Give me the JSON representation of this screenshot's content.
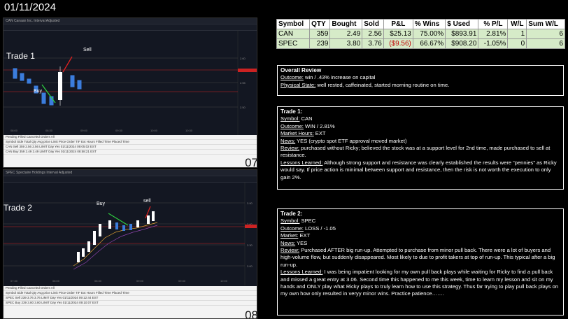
{
  "date": "01/11/2024",
  "trade1_shot": {
    "label": "Trade 1",
    "buy": "Buy",
    "sell": "Sell",
    "big_number": "07",
    "toolbar": "CAN  Canaan Inc.  Interval  Adjusted",
    "panel_tabs": "Pending  Filled  Canceled  Orders  All",
    "panel_cols": "Symbol  Side  Total Qty  Avg price  Limit Price  Order  TIF  Ext Hours  Filled Time  Placed Time",
    "rows": [
      "CAN  Sell  359  2.56  2.56  LIMIT  Day  Yes  01/11/2024 09:05:02 EST",
      "CAN  Buy  359  2.49  2.49  LIMIT  Day  Yes  01/11/2024 08:58:21 EST"
    ]
  },
  "trade2_shot": {
    "label": "Trade 2",
    "buy": "Buy",
    "sell": "sell",
    "big_number": "08",
    "toolbar": "SPEC  Spectaire Holdings  Interval  Adjusted",
    "panel_tabs": "Pending  Filled  Canceled  Orders  All",
    "panel_cols": "Symbol  Side  Total Qty  Avg price  Limit Price  Order  TIF  Ext Hours  Filled Time  Placed Time",
    "rows": [
      "SPEC  Sell  239  3.76  3.76  LIMIT  Day  Yes  01/11/2024 09:12:44 EST",
      "SPEC  Buy  239  3.80  3.80  LIMIT  Day  Yes  01/11/2024 09:10:07 EST"
    ]
  },
  "table": {
    "headers": [
      "Symbol",
      "QTY",
      "Bought",
      "Sold",
      "P&L",
      "% Wins",
      "$ Used",
      "% P/L",
      "W/L",
      "Sum W/L"
    ],
    "rows": [
      [
        "CAN",
        "359",
        "2.49",
        "2.56",
        "$25.13",
        "75.00%",
        "$893.91",
        "2.81%",
        "1",
        "6"
      ],
      [
        "SPEC",
        "239",
        "3.80",
        "3.76",
        "($9.56)",
        "66.67%",
        "$908.20",
        "-1.05%",
        "0",
        "6"
      ]
    ]
  },
  "overall": {
    "title": "Overall Review",
    "l1_label": "Outcome:",
    "l1_text": " win / .43% increase on capital",
    "l2_label": "Physical State:",
    "l2_text": " well rested, caffeinated, started morning routine on time."
  },
  "trade1": {
    "title": "Trade 1:",
    "symbol_label": "Symbol:",
    "symbol": " CAN",
    "outcome_label": "Outcome:",
    "outcome": " WIN / 2.81%",
    "hours_label": "Market Hours:",
    "hours": " EXT",
    "news_label": "News:",
    "news": " YES (crypto spot ETF approval moved market)",
    "review_label": "Review:",
    "review": " purchased without Ricky; believed the stock was at a support level for 2nd time, made purchased to sell at resistance.",
    "lessons_label": "Lessons Learned:",
    "lessons": "  Although strong support and resistance was clearly established the results were “pennies” as Ricky would say.  If price action is minimal between support and resistance, then the risk is not worth the execution to only gain 2%."
  },
  "trade2": {
    "title": "Trade 2:",
    "symbol_label": "Symbol:",
    "symbol": " SPEC",
    "outcome_label": "Outcome:",
    "outcome": " LOSS / -1.05",
    "market_label": "Market:",
    "market": " EXT",
    "news_label": "News:",
    "news": " YES",
    "review_label": "Review:",
    "review": " Purchased AFTER big run-up.  Attempted to purchase from minor pull back.  There were a lot of buyers and high-volume flow, but suddenly disappeared.  Most likely to due to profit takers at top of run-up.  This typical after a big run-up.",
    "lessons_label": "Lessons Learned:",
    "lessons": " I was being impatient looking for my own pull back plays while waiting for Ricky to find a pull back and missed a great entry at 3.06.  Second time this happened to me this week, time to learn my lesson and sit on my hands and ONLY play what Ricky plays to truly learn how to use this strategy.  Thus far trying to play pull back plays on my own how only resulted in veryy minor wins.  Practice patience……."
  }
}
